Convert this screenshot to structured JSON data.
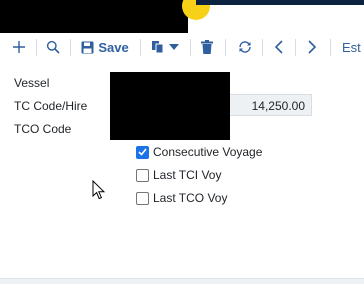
{
  "toolbar": {
    "save_label": "Save",
    "partial_label": "Est"
  },
  "form": {
    "vessel_label": "Vessel",
    "tc_code_label": "TC Code/Hire",
    "tc_hire_value": "14,250.00",
    "tco_code_label": "TCO Code"
  },
  "checkboxes": [
    {
      "label": "Consecutive Voyage",
      "checked": true
    },
    {
      "label": "Last TCI Voy",
      "checked": false
    },
    {
      "label": "Last TCO Voy",
      "checked": false
    }
  ],
  "colors": {
    "accent": "#2f5f9e",
    "checkbox": "#1a73e8",
    "header_yellow": "#f7d117",
    "header_navy": "#0c2340"
  }
}
